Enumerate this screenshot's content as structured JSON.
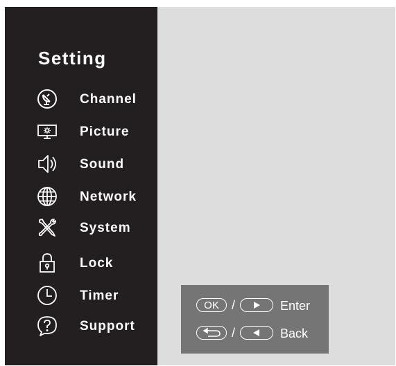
{
  "menu": {
    "title": "Setting",
    "items": [
      {
        "label": "Channel",
        "icon": "satellite-dish-icon"
      },
      {
        "label": "Picture",
        "icon": "monitor-brightness-icon"
      },
      {
        "label": "Sound",
        "icon": "speaker-icon"
      },
      {
        "label": "Network",
        "icon": "globe-icon"
      },
      {
        "label": "System",
        "icon": "tools-icon"
      },
      {
        "label": "Lock",
        "icon": "padlock-icon"
      },
      {
        "label": "Timer",
        "icon": "clock-icon"
      },
      {
        "label": "Support",
        "icon": "help-bubble-icon"
      }
    ]
  },
  "hints": {
    "enter": {
      "key1": "OK",
      "separator": "/",
      "key2_icon": "play-right-icon",
      "label": "Enter"
    },
    "back": {
      "key1_icon": "return-arrow-icon",
      "separator": "/",
      "key2_icon": "play-left-icon",
      "label": "Back"
    }
  }
}
